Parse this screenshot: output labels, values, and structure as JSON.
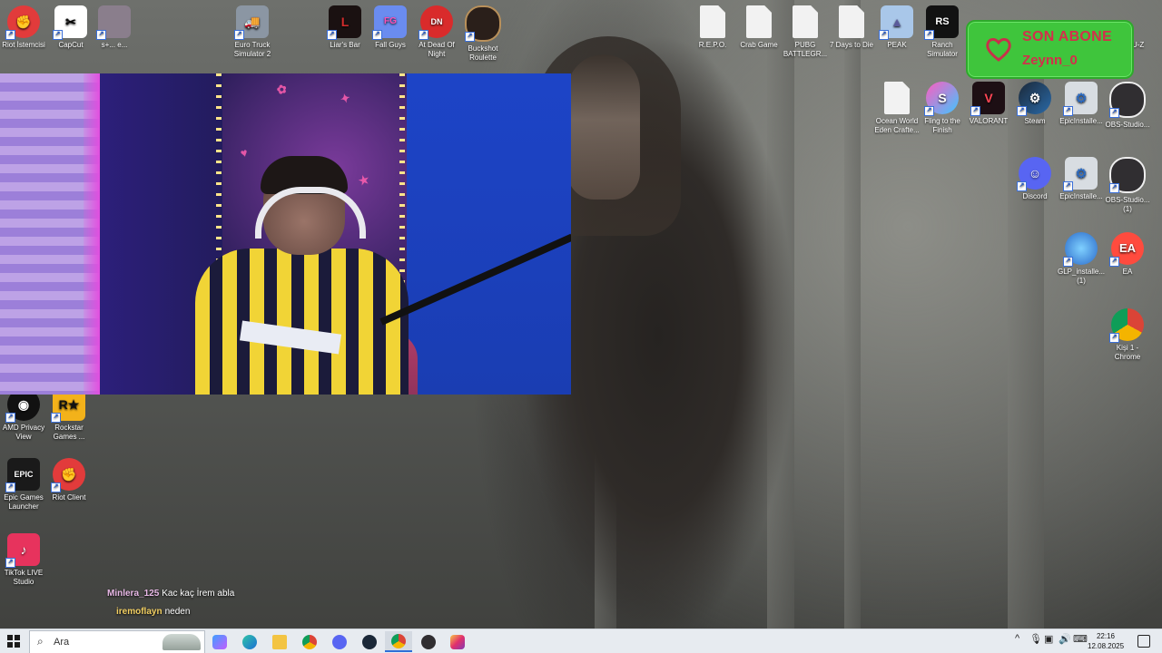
{
  "desktop_icons": {
    "riot_istemcisi": "Riot İstemcisi",
    "capcut": "CapCut",
    "shortcut3": "s+...  e...",
    "euro_truck": "Euro Truck Simulator 2",
    "liars_bar": "Liar's Bar",
    "fall_guys": "Fall Guys",
    "at_dead_of_night": "At Dead Of Night",
    "buckshot": "Buckshot Roulette",
    "repo": "R.E.P.O.",
    "crab_game": "Crab Game",
    "pubg": "PUBG BATTLEGR...",
    "seven_days": "7 Days to Die",
    "peak": "PEAK",
    "ranch": "Ranch Simulator",
    "pu_z": "PU-Z",
    "ocean_world": "Ocean World Eden Crafte...",
    "fling": "Fling to the Finish",
    "valorant": "VALORANT",
    "steam": "Steam",
    "epic_installer": "EpicInstalle...",
    "obs": "OBS-Studio...",
    "discord": "Discord",
    "epic_installer2": "EpicInstalle...",
    "obs2": "OBS-Studio... (1)",
    "glp": "GLP_installe... (1)",
    "ea": "EA",
    "chrome_kisi": "Kişi 1 - Chrome",
    "amd_privacy": "AMD Privacy View",
    "rockstar": "Rockstar Games ...",
    "epic_launcher": "Epic Games Launcher",
    "riot_client": "Riot Client",
    "tiktok": "TikTok LIVE Studio"
  },
  "alert": {
    "title": "SON ABONE",
    "name": "Zeynn_0",
    "color": "#3fc53c"
  },
  "chat": [
    {
      "user": "Minlera_125",
      "message": "Kac kaç İrem abla"
    },
    {
      "user": "iremoflayn",
      "message": "neden"
    }
  ],
  "taskbar": {
    "search_placeholder": "Ara",
    "time": "22:16",
    "date": "12.08.2025",
    "apps": [
      "copilot-icon",
      "edge-icon",
      "file-explorer-icon",
      "chrome-icon",
      "discord-icon",
      "steam-icon",
      "chrome-icon",
      "obs-icon",
      "instagram-icon"
    ]
  }
}
